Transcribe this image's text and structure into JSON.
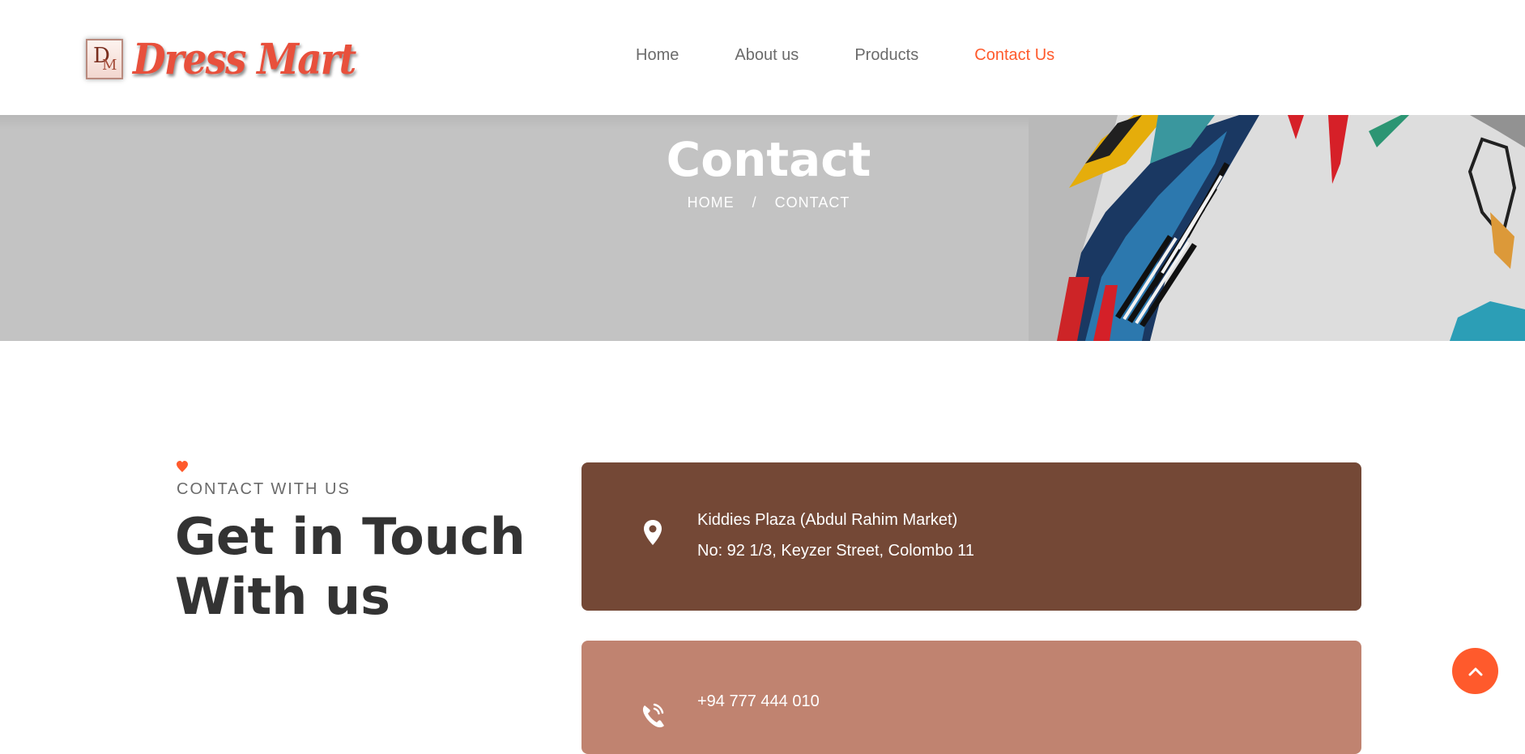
{
  "brand": {
    "logo_mark": "DM",
    "logo_text": "Dress Mart"
  },
  "nav": {
    "items": [
      {
        "label": "Home",
        "active": false
      },
      {
        "label": "About us",
        "active": false
      },
      {
        "label": "Products",
        "active": false
      },
      {
        "label": "Contact Us",
        "active": true
      }
    ]
  },
  "banner": {
    "title": "Contact",
    "breadcrumb": [
      "HOME",
      "/",
      "CONTACT"
    ]
  },
  "intro": {
    "eyebrow": "CONTACT WITH US",
    "headline_line1": "Get in Touch",
    "headline_line2": "With us"
  },
  "contact_cards": {
    "address": {
      "icon": "location-pin-icon",
      "line1": "Kiddies Plaza (Abdul Rahim Market)",
      "line2": "No: 92 1/3, Keyzer Street, Colombo 11",
      "color": "#744836"
    },
    "phone": {
      "icon": "phone-icon",
      "line1": "+94 777 444 010",
      "color": "#c08370"
    }
  },
  "colors": {
    "accent": "#ff5a2c",
    "heading": "#333333",
    "banner_bg": "#c3c3c3"
  },
  "scroll_top": {
    "icon": "chevron-up-icon"
  }
}
